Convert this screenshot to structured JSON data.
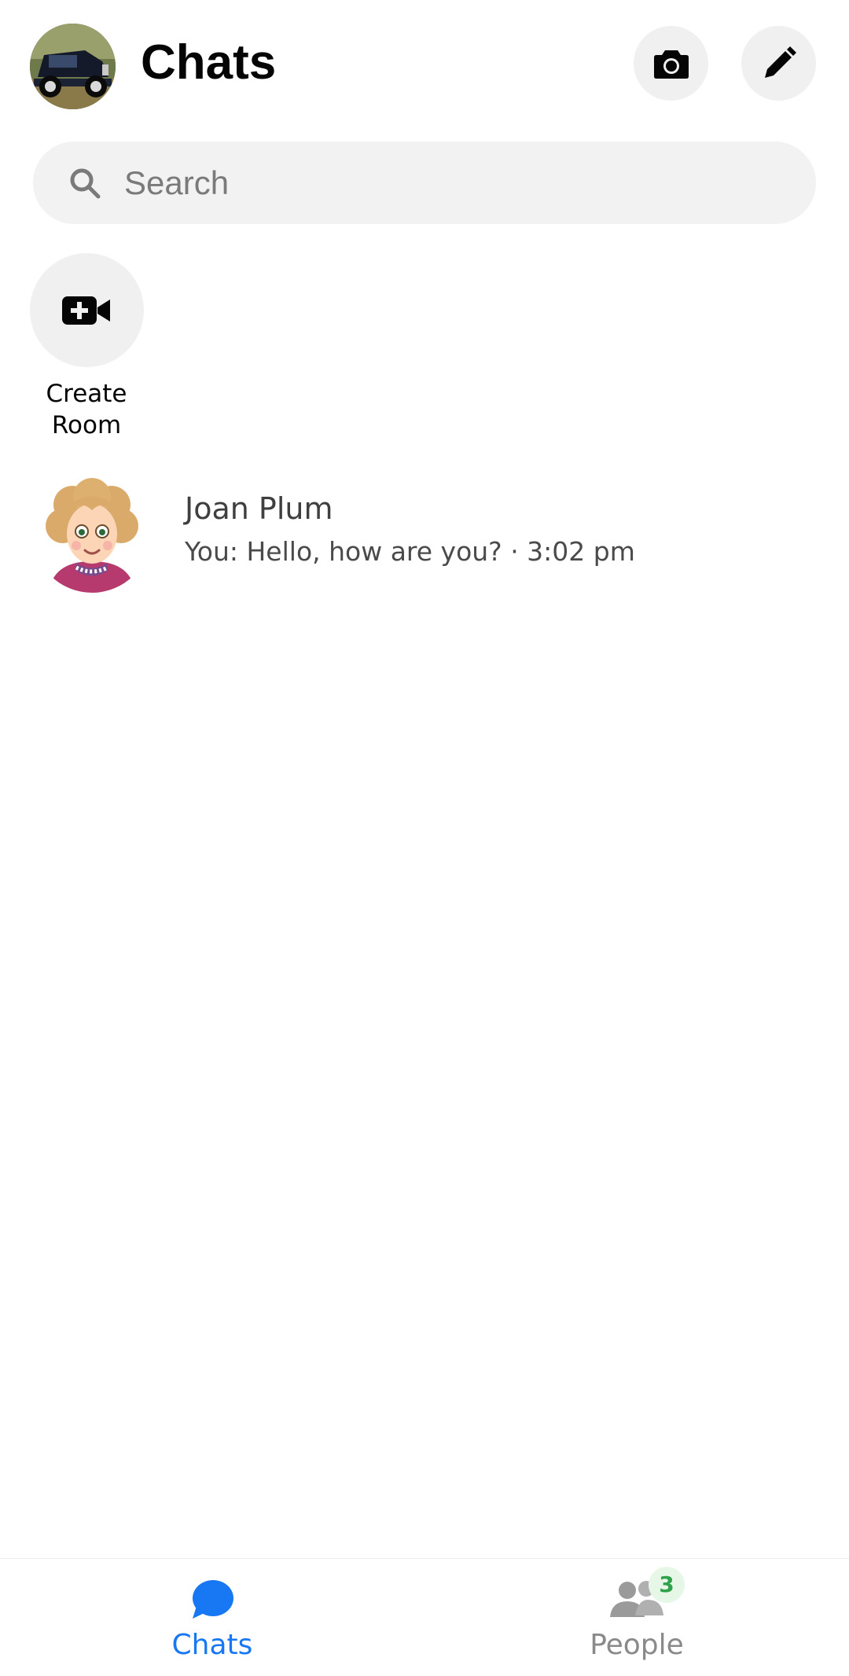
{
  "header": {
    "title": "Chats",
    "avatar_icon": "vintage-car-photo",
    "camera_icon": "camera-icon",
    "compose_icon": "pencil-icon"
  },
  "search": {
    "placeholder": "Search",
    "value": ""
  },
  "create_room": {
    "label": "Create\nRoom",
    "icon": "video-plus-icon"
  },
  "chats": [
    {
      "name": "Joan Plum",
      "preview": "You: Hello, how are you? · 3:02 pm",
      "avatar_icon": "cartoon-woman-avatar"
    }
  ],
  "bottom_nav": {
    "chats_label": "Chats",
    "people_label": "People",
    "people_badge": "3",
    "active_color": "#1877f2",
    "inactive_color": "#8a8a8a",
    "badge_color": "#31a24c"
  }
}
